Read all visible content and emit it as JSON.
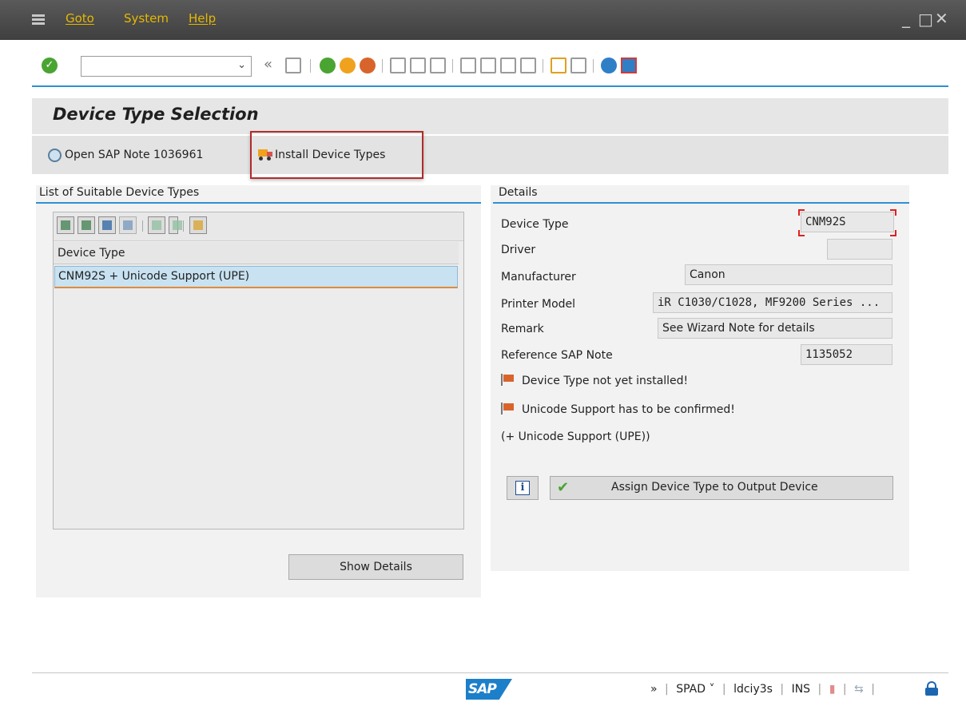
{
  "menu": {
    "items": [
      "Goto",
      "System",
      "Help"
    ],
    "window_controls": [
      "_",
      "□",
      "✕"
    ]
  },
  "toolbar": {
    "command_field_value": "",
    "collapse_glyph": "«"
  },
  "screen": {
    "title": "Device Type Selection"
  },
  "app_toolbar": {
    "open_note_label": "Open SAP Note 1036961",
    "install_label": "Install Device Types"
  },
  "list_group": {
    "title": "List of Suitable Device Types",
    "column_header": "Device Type",
    "rows": [
      "CNM92S + Unicode Support (UPE)"
    ],
    "show_details_label": "Show Details"
  },
  "details": {
    "title": "Details",
    "fields": [
      {
        "label": "Device Type",
        "value": "CNM92S"
      },
      {
        "label": "Driver",
        "value": ""
      },
      {
        "label": "Manufacturer",
        "value": "Canon"
      },
      {
        "label": "Printer Model",
        "value": "iR C1030/C1028, MF9200 Series ..."
      },
      {
        "label": "Remark",
        "value": "See Wizard Note for details"
      },
      {
        "label": "Reference SAP Note",
        "value": "1135052"
      }
    ],
    "messages": [
      "Device Type not yet installed!",
      "Unicode Support has to be confirmed!"
    ],
    "note_line": "(+ Unicode Support (UPE))",
    "info_glyph": "i",
    "assign_label": "Assign Device Type to Output Device"
  },
  "status_bar": {
    "logo_text": "SAP",
    "expand": "»",
    "transaction": "SPAD",
    "dropdown": "˅",
    "system": "ldciy3s",
    "mode": "INS"
  },
  "colors": {
    "accent_blue": "#2f8fd3",
    "highlight_red": "#b22a2a",
    "selected_row": "#c8e2f1",
    "menu_text": "#e6b800"
  }
}
